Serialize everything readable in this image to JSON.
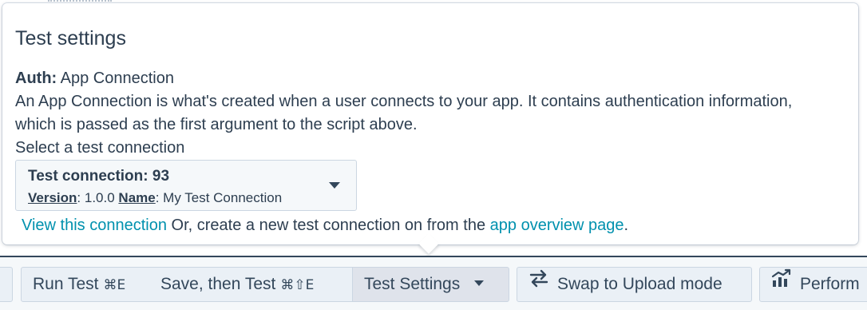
{
  "popover": {
    "title": "Test settings",
    "auth_label": "Auth:",
    "auth_value": "App Connection",
    "description": "An App Connection is what's created when a user connects to your app. It contains authentication information, which is passed as the first argument to the script above.",
    "select_prompt": "Select a test connection",
    "selected_connection": {
      "title": "Test connection: 93",
      "version_label": "Version",
      "version_value": ": 1.0.0",
      "name_label": "Name",
      "name_value": ": My Test Connection"
    },
    "view_link": "View this connection",
    "footer_text": "Or, create a new test connection on from the",
    "overview_link": "app overview page",
    "footer_period": "."
  },
  "toolbar": {
    "run_test_label": "Run Test",
    "run_test_shortcut": "⌘E",
    "save_test_label": "Save, then Test",
    "save_test_shortcut": "⌘⇧E",
    "test_settings_label": "Test Settings",
    "swap_label": "Swap to Upload mode",
    "perform_label": "Perform"
  },
  "colors": {
    "link": "#0091ae",
    "text": "#2d3e50",
    "toolbar_bg": "#f5f8fa",
    "button_bg": "#eaf0f6",
    "active_button_bg": "#dfe3eb"
  },
  "icons": {
    "swap": "swap-arrows-icon",
    "perform": "chart-trend-icon",
    "dropdown": "chevron-down-icon"
  }
}
